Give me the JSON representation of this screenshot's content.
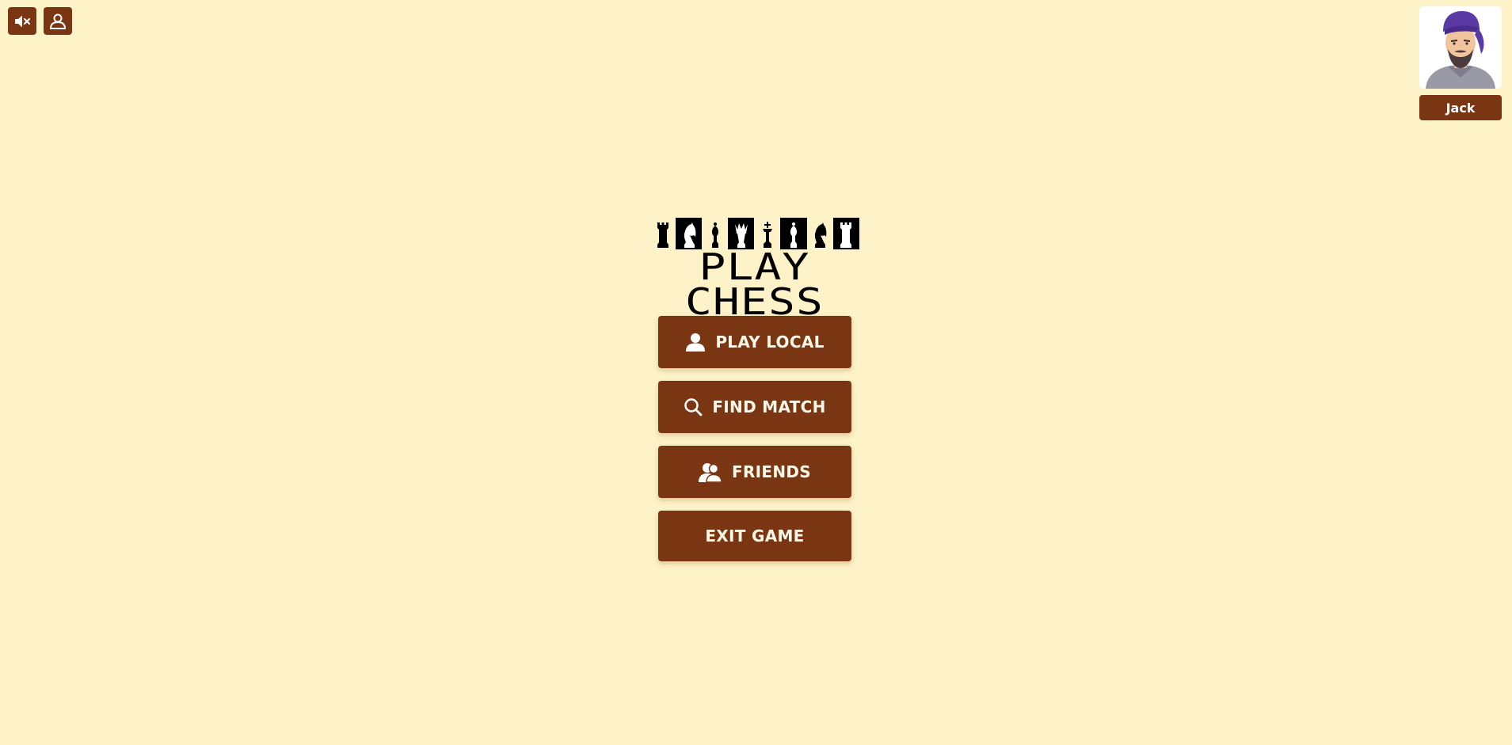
{
  "toolbar": {
    "mute_icon": "speaker-muted-icon",
    "profile_icon": "user-silhouette-icon"
  },
  "profile": {
    "name": "Jack",
    "avatar_icon": "character-portrait"
  },
  "logo": {
    "title": "PLAY CHESS",
    "pieces": [
      "rook",
      "knight",
      "bishop",
      "queen",
      "king",
      "bishop",
      "knight",
      "rook"
    ]
  },
  "menu": {
    "play_local": {
      "label": "PLAY LOCAL",
      "icon": "person-icon"
    },
    "find_match": {
      "label": "FIND MATCH",
      "icon": "search-icon"
    },
    "friends": {
      "label": "FRIENDS",
      "icon": "friends-icon"
    },
    "exit_game": {
      "label": "EXIT GAME"
    }
  },
  "colors": {
    "background": "#fdf2c8",
    "button": "#7a3613",
    "button_text": "#fff8e8",
    "logo": "#000000"
  }
}
